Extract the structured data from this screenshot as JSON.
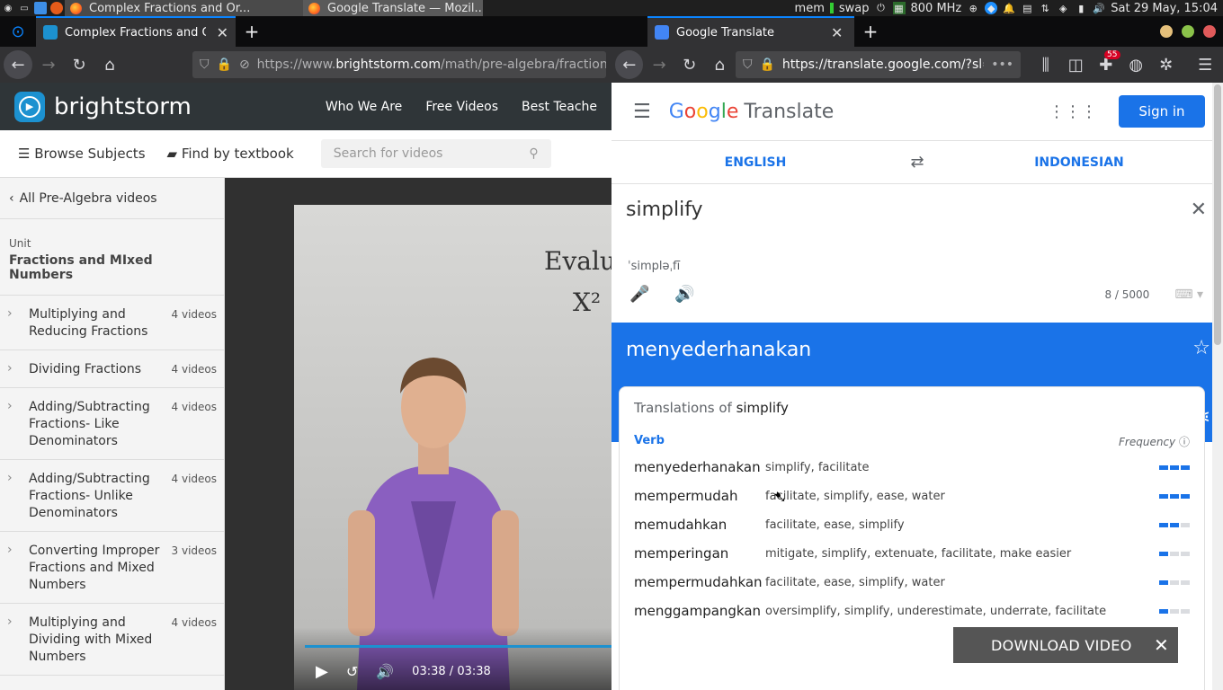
{
  "taskbar": {
    "tasks": [
      "Complex Fractions and Or...",
      "Google Translate — Mozil..."
    ],
    "mem_label": "mem",
    "swap_label": "swap",
    "cpu_freq": "800 MHz",
    "datetime": "Sat 29 May, 15:04"
  },
  "left_browser": {
    "tab_title": "Complex Fractions and Ord",
    "url_prefix": "https://www.",
    "url_host": "brightstorm.com",
    "url_path": "/math/pre-algebra/fractions-",
    "site": {
      "logo": "brightstorm",
      "nav": [
        "Who We Are",
        "Free Videos",
        "Best Teacher"
      ],
      "browse_subjects": "Browse Subjects",
      "find_by_textbook": "Find by textbook",
      "search_placeholder": "Search for videos",
      "back_link": "All Pre-Algebra videos",
      "unit_label": "Unit",
      "unit_name": "Fractions and MIxed Numbers",
      "items": [
        {
          "title": "Multiplying and Reducing Fractions",
          "count": "4 videos"
        },
        {
          "title": "Dividing Fractions",
          "count": "4 videos"
        },
        {
          "title": "Adding/Subtracting Fractions- Like Denominators",
          "count": "4 videos"
        },
        {
          "title": "Adding/Subtracting Fractions- Unlike Denominators",
          "count": "4 videos"
        },
        {
          "title": "Converting Improper Fractions and Mixed Numbers",
          "count": "3 videos"
        },
        {
          "title": "Multiplying and Dividing with Mixed Numbers",
          "count": "4 videos"
        }
      ],
      "video": {
        "whiteboard_line1": "Evalua",
        "whiteboard_line2": "X²",
        "time_current": "03:38",
        "time_sep": "/",
        "time_total": "03:38",
        "progress": 1.0
      }
    }
  },
  "right_browser": {
    "tab_title": "Google Translate",
    "url": "https://translate.google.com/?sl=en&",
    "badge": "55",
    "gt": {
      "logo_google": "Google",
      "logo_translate": "Translate",
      "sign_in": "Sign in",
      "source_lang": "ENGLISH",
      "target_lang": "INDONESIAN",
      "source_text": "simplify",
      "phonetic": "ˈsimpləˌfī",
      "char_count": "8 / 5000",
      "translation": "menyederhanakan",
      "translations_of_prefix": "Translations of",
      "translations_of_word": "simplify",
      "pos": "Verb",
      "frequency_label": "Frequency",
      "rows": [
        {
          "word": "menyederhanakan",
          "synonyms": "simplify, facilitate",
          "freq": 3
        },
        {
          "word": "mempermudah",
          "synonyms": "facilitate, simplify, ease, water",
          "freq": 3
        },
        {
          "word": "memudahkan",
          "synonyms": "facilitate, ease, simplify",
          "freq": 2
        },
        {
          "word": "memperingan",
          "synonyms": "mitigate, simplify, extenuate, facilitate, make easier",
          "freq": 1
        },
        {
          "word": "mempermudahkan",
          "synonyms": "facilitate, ease, simplify, water",
          "freq": 1
        },
        {
          "word": "menggampangkan",
          "synonyms": "oversimplify, simplify, underestimate, underrate, facilitate",
          "freq": 1
        }
      ]
    },
    "download_banner": "DOWNLOAD VIDEO"
  }
}
